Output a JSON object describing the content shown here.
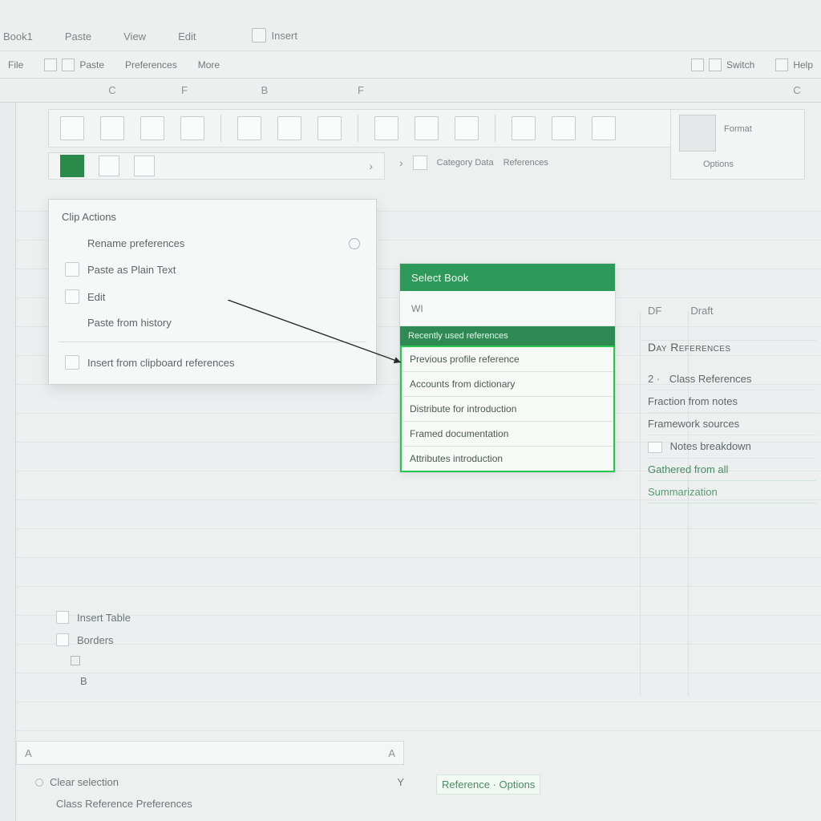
{
  "topTabs": {
    "t0": "Book1",
    "t1": "Paste",
    "t2": "View",
    "t3": "Edit",
    "t4": "Insert"
  },
  "cmdBar": {
    "g0": "File",
    "g1": "Paste",
    "g2": "Preferences",
    "g3": "More",
    "r0": "Switch",
    "r1": "Help"
  },
  "colHeaders": {
    "c0": "C",
    "c1": "F",
    "c2": "B",
    "c3": "F",
    "c4": "C"
  },
  "ribbonBreak": {
    "lbl0": "Category Data",
    "lbl1": "References"
  },
  "ribbonRight": {
    "lbl1": "Format",
    "lbl2": "Options"
  },
  "ctxMenu": {
    "header": "Clip Actions",
    "items": {
      "i0": "Rename preferences",
      "i1": "Paste as Plain Text",
      "i2": "Edit",
      "i3": "Paste from history",
      "i4": "Insert from clipboard references"
    }
  },
  "lowerLeft": {
    "l0": "Insert Table",
    "l1": "Borders",
    "l2": "B"
  },
  "formulaBar": {
    "nameBox": "A",
    "right": "A"
  },
  "status": {
    "s0": "Clear selection",
    "s1": "Class Reference Preferences"
  },
  "greenPanel": {
    "head": "Select Book",
    "sub": "WI",
    "band": "Recently used references",
    "list": {
      "r0": "Previous profile reference",
      "r1": "Accounts from dictionary",
      "r2": "Distribute for introduction",
      "r3": "Framed documentation",
      "r4": "Attributes introduction"
    }
  },
  "rightBlock": {
    "hd0": "DF",
    "hd1": "Draft",
    "title": "Day References",
    "rows": {
      "r0": "Class References",
      "r1": "Fraction from notes",
      "r2": "Framework sources",
      "r3": "Notes breakdown",
      "r4": "Gathered from all",
      "r5": "Summarization"
    }
  },
  "brGroup": "Reference · Options"
}
